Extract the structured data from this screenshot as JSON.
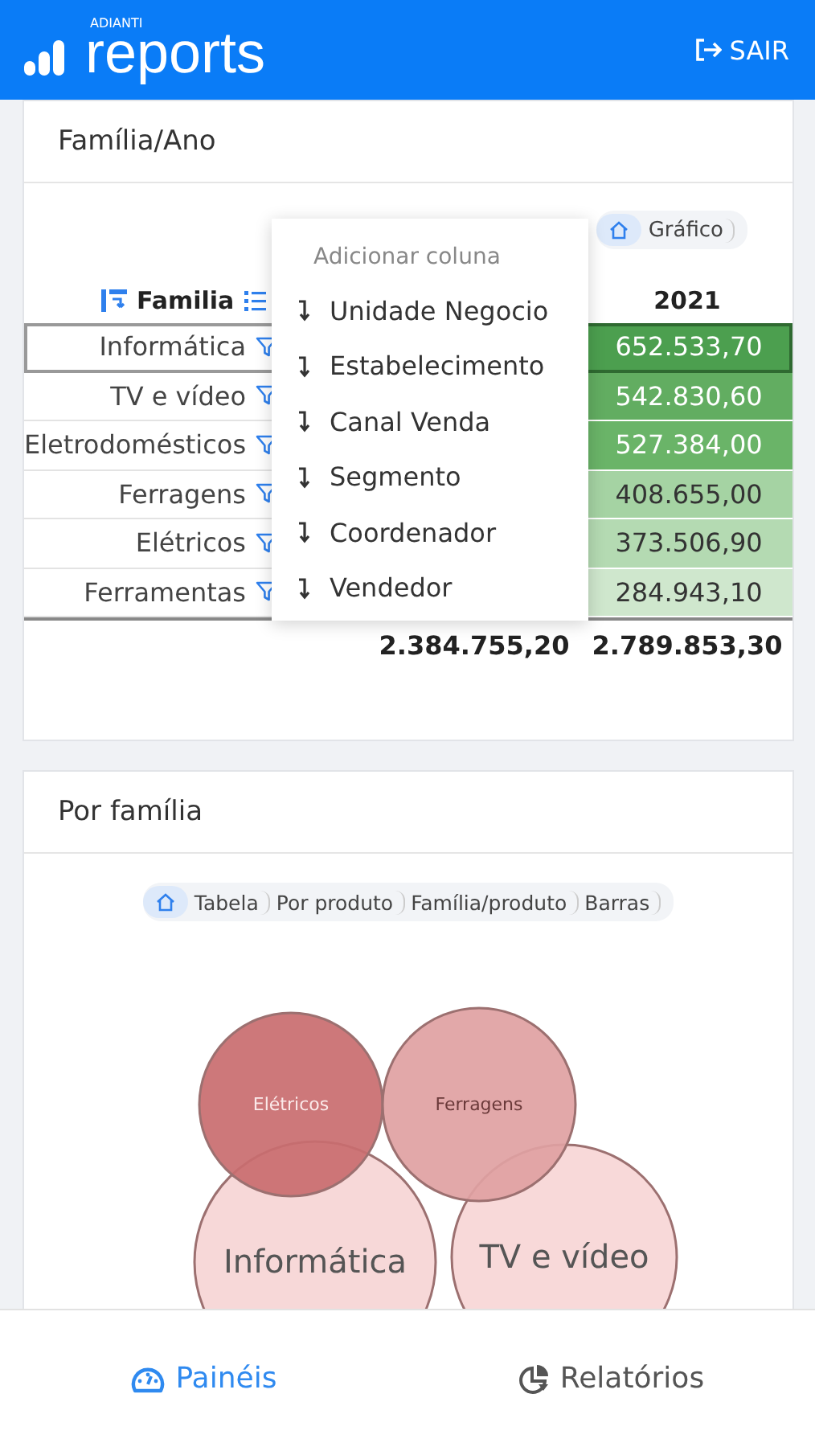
{
  "header": {
    "logo_small": "ADIANTI",
    "logo": "reports",
    "logout": "SAIR"
  },
  "pivot_card": {
    "title": "Família/Ano",
    "breadcrumb": [
      "Gráfico"
    ],
    "table": {
      "row_header": "Familia",
      "column_3": "2021",
      "rows": [
        {
          "family": "Informática",
          "selected": true,
          "value": "652.533,70",
          "color": "#4c9f4f"
        },
        {
          "family": "TV e vídeo",
          "selected": false,
          "value": "542.830,60",
          "color": "#62ad61"
        },
        {
          "family": "Eletrodomésticos",
          "selected": false,
          "value": "527.384,00",
          "color": "#6ab468"
        },
        {
          "family": "Ferragens",
          "selected": false,
          "value": "408.655,00",
          "color": "#a5d3a3"
        },
        {
          "family": "Elétricos",
          "selected": false,
          "value": "373.506,90",
          "color": "#b4dab2"
        },
        {
          "family": "Ferramentas",
          "selected": false,
          "value": "284.943,10",
          "color": "#cfe7cd"
        }
      ],
      "totals": [
        "2.384.755,20",
        "2.789.853,30"
      ]
    },
    "menu": {
      "title": "Adicionar coluna",
      "items": [
        "Unidade Negocio",
        "Estabelecimento",
        "Canal Venda",
        "Segmento",
        "Coordenador",
        "Vendedor"
      ]
    }
  },
  "bubble_card": {
    "title": "Por família",
    "breadcrumb": [
      "Tabela",
      "Por produto",
      "Família/produto",
      "Barras"
    ],
    "bubbles": [
      {
        "label": "Elétricos",
        "color": "#c96c6f"
      },
      {
        "label": "Ferragens",
        "color": "#e0a1a2"
      },
      {
        "label": "Informática",
        "color": "#f6d5d5"
      },
      {
        "label": "TV e vídeo",
        "color": "#f7d6d6"
      }
    ]
  },
  "nav": [
    {
      "label": "Painéis",
      "selected": true
    },
    {
      "label": "Relatórios",
      "selected": false
    }
  ]
}
